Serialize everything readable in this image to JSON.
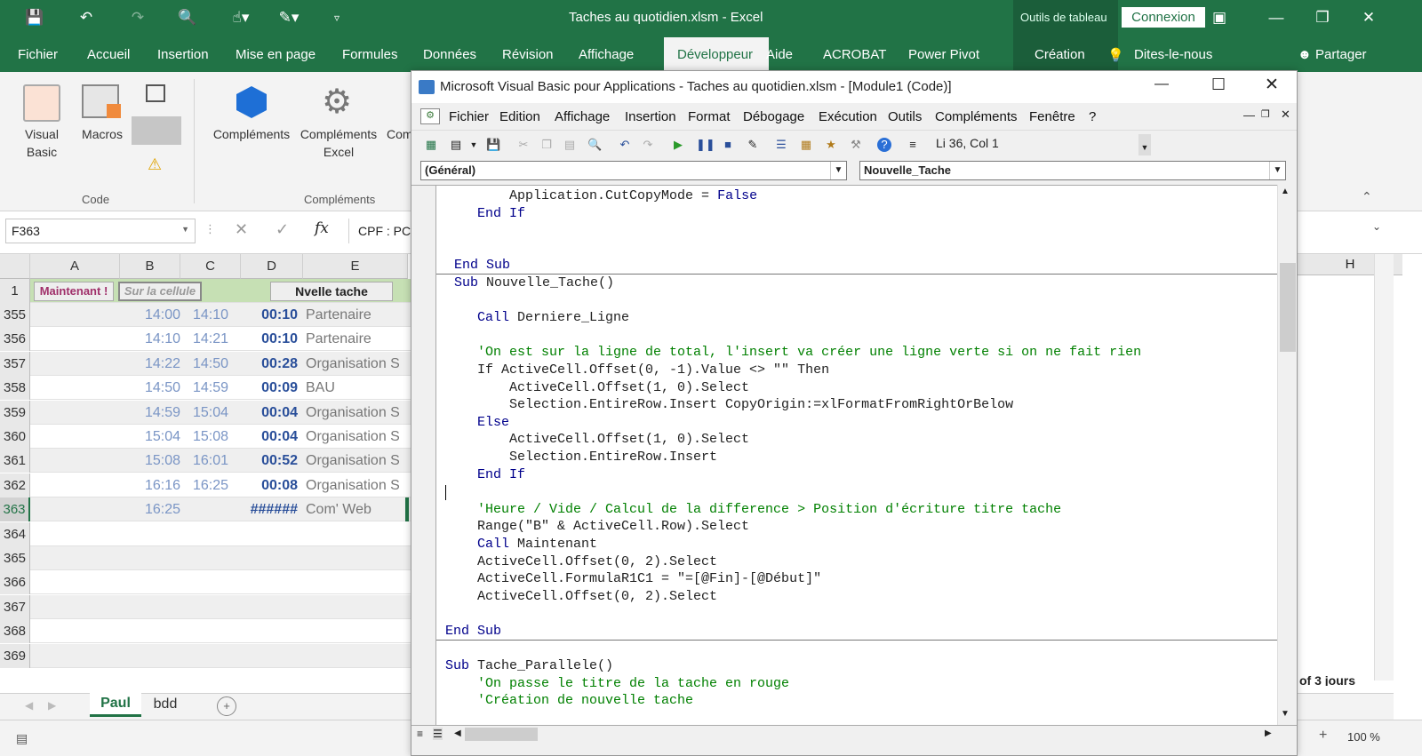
{
  "excel": {
    "title": "Taches au quotidien.xlsm  -  Excel",
    "tools_label": "Outils de tableau",
    "connexion": "Connexion",
    "tabs": [
      "Fichier",
      "Accueil",
      "Insertion",
      "Mise en page",
      "Formules",
      "Données",
      "Révision",
      "Affichage",
      "Développeur",
      "Aide",
      "ACROBAT",
      "Power Pivot",
      "Création",
      "Dites-le-nous",
      "Partager"
    ],
    "ribbon": {
      "visual_basic": "Visual Basic",
      "macros": "Macros",
      "complements": "Compléments",
      "complements_excel": "Compléments Excel",
      "com": "Com",
      "group_code": "Code",
      "group_complements": "Compléments"
    },
    "namebox": "F363",
    "formula": "CPF : PC",
    "columns": [
      "A",
      "B",
      "C",
      "D",
      "E"
    ],
    "col_h": "H",
    "row1": {
      "num": "1",
      "btn_maintenant": "Maintenant !",
      "btn_cellule": "Sur la cellule",
      "btn_nvelle": "Nvelle tache"
    },
    "rows": [
      {
        "num": "355",
        "start": "14:00",
        "end": "14:10",
        "dur": "00:10",
        "task": "Partenaire"
      },
      {
        "num": "356",
        "start": "14:10",
        "end": "14:21",
        "dur": "00:10",
        "task": "Partenaire"
      },
      {
        "num": "357",
        "start": "14:22",
        "end": "14:50",
        "dur": "00:28",
        "task": "Organisation S"
      },
      {
        "num": "358",
        "start": "14:50",
        "end": "14:59",
        "dur": "00:09",
        "task": "BAU"
      },
      {
        "num": "359",
        "start": "14:59",
        "end": "15:04",
        "dur": "00:04",
        "task": "Organisation S"
      },
      {
        "num": "360",
        "start": "15:04",
        "end": "15:08",
        "dur": "00:04",
        "task": "Organisation S"
      },
      {
        "num": "361",
        "start": "15:08",
        "end": "16:01",
        "dur": "00:52",
        "task": "Organisation S"
      },
      {
        "num": "362",
        "start": "16:16",
        "end": "16:25",
        "dur": "00:08",
        "task": "Organisation S"
      },
      {
        "num": "363",
        "start": "16:25",
        "end": "",
        "dur": "######",
        "task": "Com' Web"
      },
      {
        "num": "364",
        "start": "",
        "end": "",
        "dur": "",
        "task": ""
      },
      {
        "num": "365",
        "start": "",
        "end": "",
        "dur": "",
        "task": ""
      },
      {
        "num": "366",
        "start": "",
        "end": "",
        "dur": "",
        "task": ""
      },
      {
        "num": "367",
        "start": "",
        "end": "",
        "dur": "",
        "task": ""
      },
      {
        "num": "368",
        "start": "",
        "end": "",
        "dur": "",
        "task": ""
      },
      {
        "num": "369",
        "start": "",
        "end": "",
        "dur": "",
        "task": ""
      }
    ],
    "sheets": [
      "Paul",
      "bdd"
    ],
    "right_text": "of 3 jours",
    "zoom": "100 %"
  },
  "vba": {
    "title": "Microsoft Visual Basic pour Applications - Taches au quotidien.xlsm - [Module1 (Code)]",
    "menus": [
      "Fichier",
      "Edition",
      "Affichage",
      "Insertion",
      "Format",
      "Débogage",
      "Exécution",
      "Outils",
      "Compléments",
      "Fenêtre",
      "?"
    ],
    "position": "Li 36, Col 1",
    "combo_left": "(Général)",
    "combo_right": "Nouvelle_Tache",
    "code": [
      {
        "t": "        Application.CutCopyMode = ",
        "k": "False",
        "c": "n"
      },
      {
        "t": "    ",
        "k": "End If",
        "c": "kwline"
      },
      {
        "t": "",
        "c": "n"
      },
      {
        "t": "",
        "c": "n"
      },
      {
        "t": "",
        "k": "End Sub",
        "c": "kwline"
      },
      {
        "t": " Nouvelle_Tache()",
        "k": "Sub",
        "c": "sub"
      },
      {
        "t": "",
        "c": "n"
      },
      {
        "t": " Derniere_Ligne",
        "k": "    Call",
        "c": "sub"
      },
      {
        "t": "",
        "c": "n"
      },
      {
        "t": "    'On est sur la ligne de total, l'insert va créer une ligne verte si on ne fait rien",
        "c": "cm"
      },
      {
        "t": "    If ActiveCell.Offset(0, -1).Value <> \"\" Then",
        "c": "n"
      },
      {
        "t": "        ActiveCell.Offset(1, 0).Select",
        "c": "n"
      },
      {
        "t": "        Selection.EntireRow.Insert CopyOrigin:=xlFormatFromRightOrBelow",
        "c": "n"
      },
      {
        "t": "    Else",
        "c": "kwfull"
      },
      {
        "t": "        ActiveCell.Offset(1, 0).Select",
        "c": "n"
      },
      {
        "t": "        Selection.EntireRow.Insert",
        "c": "n"
      },
      {
        "t": "    End If",
        "c": "kwfull"
      },
      {
        "t": "",
        "c": "n"
      },
      {
        "t": "    'Heure / Vide / Calcul de la difference > Position d'écriture titre tache",
        "c": "cm"
      },
      {
        "t": "    Range(\"B\" & ActiveCell.Row).Select",
        "c": "n"
      },
      {
        "t": " Maintenant",
        "k": "    Call",
        "c": "sub"
      },
      {
        "t": "    ActiveCell.Offset(0, 2).Select",
        "c": "n"
      },
      {
        "t": "    ActiveCell.FormulaR1C1 = \"=[@Fin]-[@Début]\"",
        "c": "n"
      },
      {
        "t": "    ActiveCell.Offset(0, 2).Select",
        "c": "n"
      },
      {
        "t": "",
        "c": "n"
      },
      {
        "t": "End Sub",
        "c": "kwfull"
      },
      {
        "t": "",
        "c": "n"
      },
      {
        "t": " Tache_Parallele()",
        "k": "Sub",
        "c": "sub"
      },
      {
        "t": "    'On passe le titre de la tache en rouge",
        "c": "cm"
      },
      {
        "t": "    'Création de nouvelle tache",
        "c": "cm"
      }
    ]
  }
}
